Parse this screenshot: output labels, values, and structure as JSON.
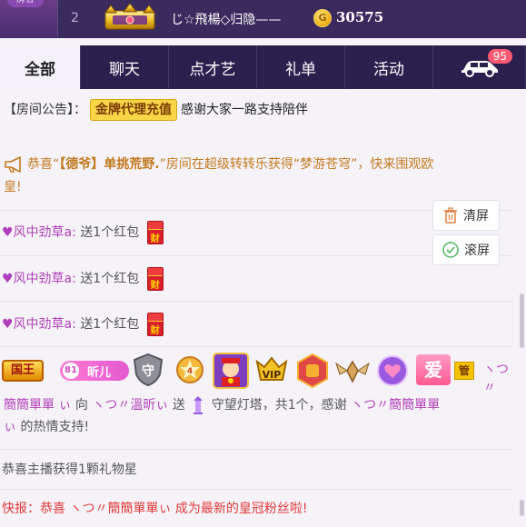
{
  "rank_strip": {
    "side_label": "房客",
    "rank": "2",
    "name": "じ☆飛楊◇归隐——",
    "score": "30575"
  },
  "tabs": [
    {
      "label": "全部",
      "active": true
    },
    {
      "label": "聊天"
    },
    {
      "label": "点才艺"
    },
    {
      "label": "礼单"
    },
    {
      "label": "活动"
    }
  ],
  "car_badge": "95",
  "notice": {
    "label": "【房间公告】：",
    "tag": "金牌代理充值",
    "text": "感谢大家一路支持陪伴"
  },
  "broadcast": {
    "part1": "恭喜“",
    "highlight": "【德爷】单挑荒野.",
    "part2": "”房间在超级转转乐获得“梦游苍穹”，快来围观欧",
    "part3": "皇!"
  },
  "gifts": [
    {
      "user": "♥风中劲草a:",
      "text": "送1个红包",
      "icon": "财"
    },
    {
      "user": "♥风中劲草a:",
      "text": "送1个红包",
      "icon": "财"
    },
    {
      "user": "♥风中劲草a:",
      "text": "送1个红包",
      "icon": "财"
    }
  ],
  "side_buttons": {
    "clear": "清屏",
    "scroll": "滚屏"
  },
  "badge_row": {
    "king": "国王",
    "level": "81",
    "level_name": "昕儿",
    "love": "爱",
    "manager": "管"
  },
  "guard_message": {
    "sender_prefix": "ヽつ〃",
    "sender": "簡簡單單",
    "sender_suffix": "ぃ",
    "to_text": "向",
    "receiver": "ヽつ〃溫昕ぃ",
    "send": "送",
    "gift": "守望灯塔，共1个，感谢",
    "thanks_name": "ヽつ〃簡簡單單",
    "thanks_name2": "ぃ",
    "end": "的热情支持!"
  },
  "star_message": "恭喜主播获得1颗礼物星",
  "flash_message": {
    "prefix": "快报：恭喜",
    "name": "ヽつ〃簡簡單單ぃ",
    "suffix": "成为最新的皇冠粉丝啦!"
  },
  "colors": {
    "tab_bar": "#2b1f4d",
    "rank_bar": "#3a2a5e",
    "gold_tag": "#f9d648",
    "purple_name": "#b040b9",
    "red_text": "#e03a3a"
  }
}
